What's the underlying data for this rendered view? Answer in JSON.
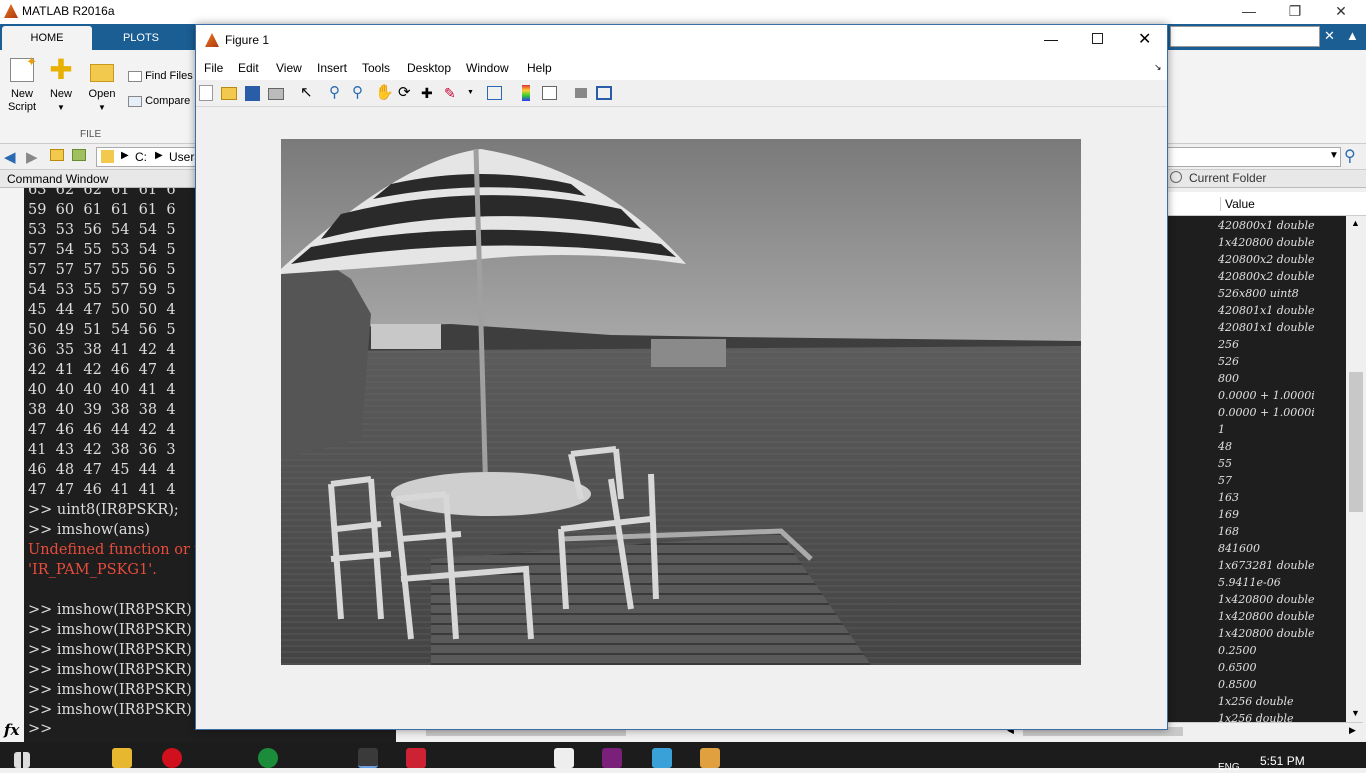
{
  "app_title": "MATLAB R2016a",
  "ribbon": {
    "tabs": [
      "HOME",
      "PLOTS"
    ],
    "new_script": [
      "New",
      "Script"
    ],
    "new": "New",
    "open": "Open",
    "find_files": "Find Files",
    "compare": "Compare",
    "group_label": "FILE"
  },
  "path": {
    "drive": "C:",
    "segment": "Users"
  },
  "command_window": {
    "title": "Command Window",
    "numeric_rows": [
      "63  62  62  61  61  6",
      "59  60  61  61  61  6",
      "53  53  56  54  54  5",
      "57  54  55  53  54  5",
      "57  57  57  55  56  5",
      "54  53  55  57  59  5",
      "45  44  47  50  50  4",
      "50  49  51  54  56  5",
      "36  35  38  41  42  4",
      "42  41  42  46  47  4",
      "40  40  40  40  41  4",
      "38  40  39  38  38  4",
      "47  46  46  44  42  4",
      "41  43  42  38  36  3",
      "46  48  47  45  44  4",
      "47  47  46  41  41  4"
    ],
    "commands_a": [
      ">> uint8(IR8PSKR);",
      ">> imshow(ans)"
    ],
    "error_lines": [
      "Undefined function or v",
      "'IR_PAM_PSKG1'."
    ],
    "commands_b": [
      ">> imshow(IR8PSKR)",
      ">> imshow(IR8PSKR)",
      ">> imshow(IR8PSKR)",
      ">> imshow(IR8PSKR)",
      ">> imshow(IR8PSKR)",
      ">> imshow(IR8PSKR)"
    ],
    "prompt": ">>",
    "fx": "fx"
  },
  "workspace": {
    "panel_title": "Current Folder",
    "column_value": "Value",
    "values": [
      "420800x1 double",
      "1x420800 double",
      "420800x2 double",
      "420800x2 double",
      "526x800 uint8",
      "420801x1 double",
      "420801x1 double",
      "256",
      "526",
      "800",
      "0.0000 + 1.0000i",
      "0.0000 + 1.0000i",
      "1",
      "48",
      "55",
      "57",
      "163",
      "169",
      "168",
      "841600",
      "1x673281 double",
      "5.9411e-06",
      "1x420800 double",
      "1x420800 double",
      "1x420800 double",
      "0.2500",
      "0.6500",
      "0.8500",
      "1x256 double",
      "1x256 double"
    ]
  },
  "figure": {
    "title": "Figure 1",
    "menus": [
      "File",
      "Edit",
      "View",
      "Insert",
      "Tools",
      "Desktop",
      "Window",
      "Help"
    ]
  },
  "taskbar": {
    "time": "5:51 PM",
    "lang": "ENG"
  },
  "colors": {
    "ribbon_blue": "#1b5e94",
    "console_bg": "#1e1e1e",
    "error_red": "#e74c3c"
  }
}
